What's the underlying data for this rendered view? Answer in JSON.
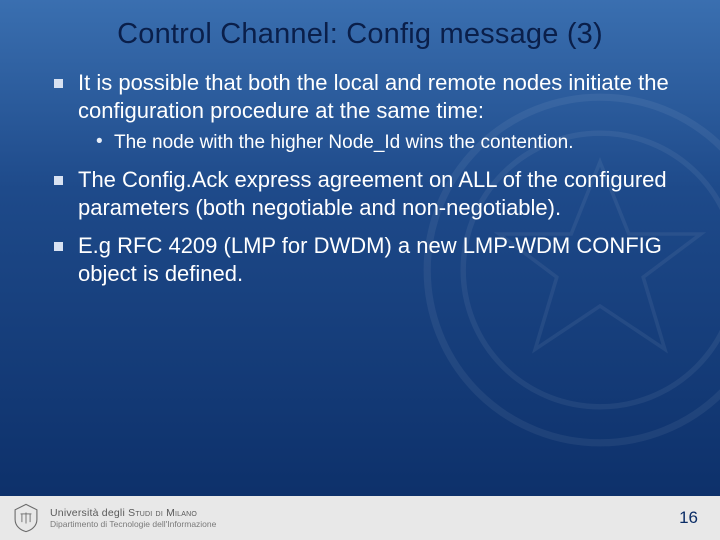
{
  "title": "Control Channel: Config message (3)",
  "bullets": {
    "b1": "It is possible that both the local and remote nodes initiate the configuration procedure at the same time:",
    "b1_sub1": "The node with the higher Node_Id wins the contention.",
    "b2": "The Config.Ack express agreement on ALL of the configured parameters (both negotiable and non-negotiable).",
    "b3": "E.g RFC 4209 (LMP for DWDM) a new LMP-WDM CONFIG object is defined."
  },
  "footer": {
    "uni_line1_a": "Università degli ",
    "uni_line1_b": "Studi di Milano",
    "uni_line2": "Dipartimento di Tecnologie dell'Informazione"
  },
  "page_number": "16"
}
